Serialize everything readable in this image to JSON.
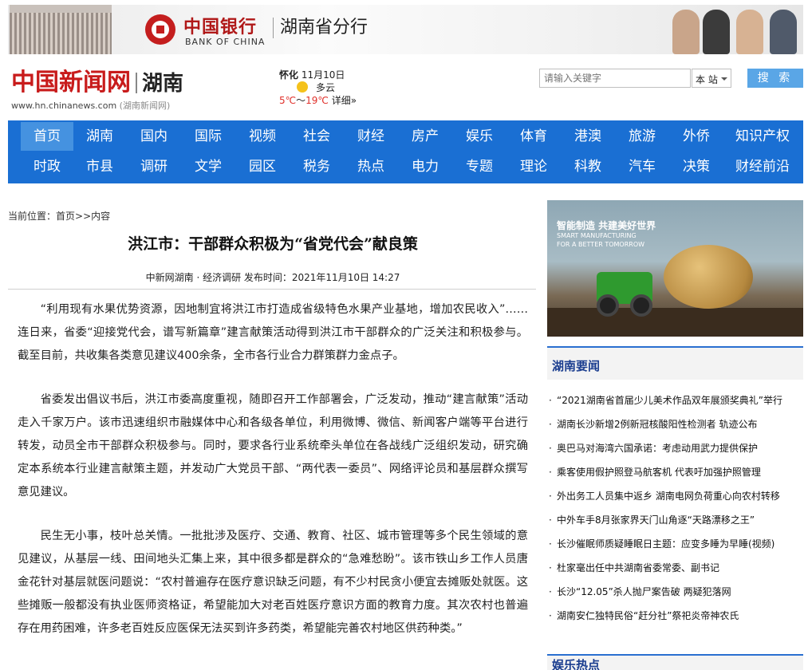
{
  "banner": {
    "bank_cn": "中国银行",
    "bank_en": "BANK OF CHINA",
    "branch": "湖南省分行"
  },
  "header": {
    "logo_cn": "中国新闻网",
    "logo_region": "湖南",
    "site_url": "www.hn.chinanews.com",
    "site_sub": "(湖南新闻网)"
  },
  "weather": {
    "city": "怀化",
    "date": "11月10日",
    "condition": "多云",
    "low": "5℃",
    "sep": "～",
    "high": "19℃",
    "detail": "详细»",
    "icon": "sun-icon"
  },
  "search": {
    "placeholder": "请输入关键字",
    "scope": "本 站",
    "button": "搜 索"
  },
  "nav": {
    "row1": [
      "首页",
      "湖南",
      "国内",
      "国际",
      "视频",
      "社会",
      "财经",
      "房产",
      "娱乐",
      "体育",
      "港澳",
      "旅游",
      "外侨",
      "知识产权"
    ],
    "row2": [
      "时政",
      "市县",
      "调研",
      "文学",
      "园区",
      "税务",
      "热点",
      "电力",
      "专题",
      "理论",
      "科教",
      "汽车",
      "决策",
      "财经前沿"
    ],
    "active": "首页"
  },
  "breadcrumb": {
    "label": "当前位置：",
    "home": "首页",
    "sep": ">>",
    "current": "内容"
  },
  "article": {
    "title": "洪江市：干部群众积极为“省党代会”献良策",
    "meta": "中新网湖南 · 经济调研  发布时间：2021年11月10日  14:27",
    "paragraphs": [
      "“利用现有水果优势资源，因地制宜将洪江市打造成省级特色水果产业基地，增加农民收入”……连日来，省委“迎接党代会，谱写新篇章”建言献策活动得到洪江市干部群众的广泛关注和积极参与。截至目前，共收集各类意见建议400余条，全市各行业合力群策群力金点子。",
      "省委发出倡议书后，洪江市委高度重视，随即召开工作部署会，广泛发动，推动“建言献策”活动走入千家万户。该市迅速组织市融媒体中心和各级各单位，利用微博、微信、新闻客户端等平台进行转发，动员全市干部群众积极参与。同时，要求各行业系统牵头单位在各战线广泛组织发动，研究确定本系统本行业建言献策主题，并发动广大党员干部、“两代表一委员”、网络评论员和基层群众撰写意见建议。",
      "民生无小事，枝叶总关情。一批批涉及医疗、交通、教育、社区、城市管理等多个民生领域的意见建议，从基层一线、田间地头汇集上来，其中很多都是群众的“急难愁盼”。该市铁山乡工作人员唐金花针对基层就医问题说：“农村普遍存在医疗意识缺乏问题，有不少村民贪小便宜去摊贩处就医。这些摊贩一般都没有执业医师资格证，希望能加大对老百姓医疗意识方面的教育力度。其次农村也普遍存在用药困难，许多老百姓反应医保无法买到许多药类，希望能完善农村地区供药种类。”"
    ]
  },
  "ad": {
    "title": "智能制造 共建美好世界",
    "sub1": "SMART MANUFACTURING",
    "sub2": "FOR A BETTER TOMORROW"
  },
  "hunan_news": {
    "heading": "湖南要闻",
    "items": [
      "“2021湖南省首届少儿美术作品双年展颁奖典礼”举行",
      "湖南长沙新增2例新冠核酸阳性检测者 轨迹公布",
      "奥巴马对海湾六国承诺：考虑动用武力提供保护",
      "乘客使用假护照登马航客机 代表吁加强护照管理",
      "外出务工人员集中返乡 湖南电网负荷重心向农村转移",
      "中外车手8月张家界天门山角逐“天路漂移之王”",
      "长沙催眠师质疑睡眠日主题：应变多睡为早睡(视频)",
      "杜家毫出任中共湖南省委常委、副书记",
      "长沙“12.05”杀人抛尸案告破 两疑犯落网",
      "湖南安仁独特民俗“赶分社”祭祀炎帝神农氏"
    ]
  },
  "next_section": {
    "heading": "娱乐热点"
  }
}
